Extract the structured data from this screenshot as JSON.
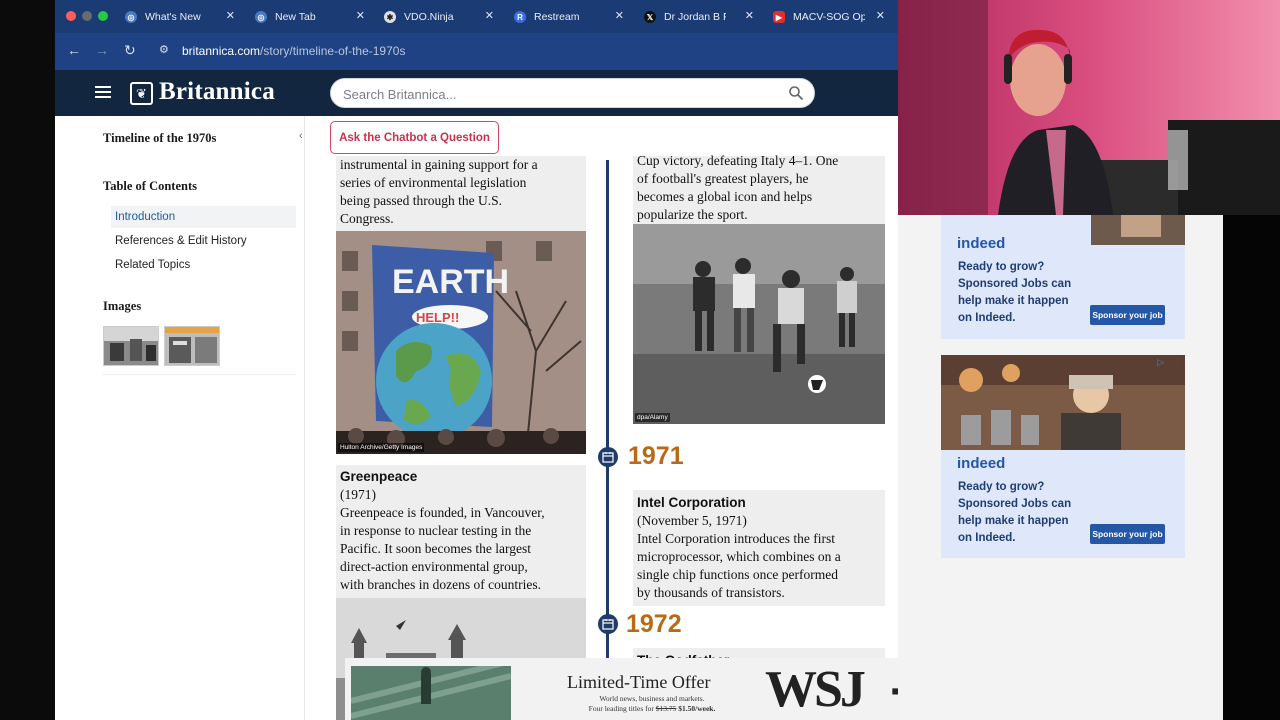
{
  "browser": {
    "tabs": [
      {
        "title": "What's New",
        "favicon": "chrome-icon",
        "color": "#4a78c2"
      },
      {
        "title": "New Tab",
        "favicon": "chrome-icon",
        "color": "#4a78c2"
      },
      {
        "title": "VDO.Ninja",
        "favicon": "vdo-ninja-icon",
        "color": "#f0f0f0"
      },
      {
        "title": "Restream",
        "favicon": "restream-icon",
        "color": "#3b6fe0"
      },
      {
        "title": "Dr Jordan B Pe",
        "favicon": "x-icon",
        "color": "#111111"
      },
      {
        "title": "MACV-SOG Op",
        "favicon": "youtube-icon",
        "color": "#e52d27"
      }
    ],
    "url_host": "britannica.com",
    "url_path": "/story/timeline-of-the-1970s"
  },
  "header": {
    "logo_text": "Britannica",
    "search_placeholder": "Search Britannica..."
  },
  "sidebar": {
    "title": "Timeline of the 1970s",
    "toc_heading": "Table of Contents",
    "toc_items": [
      {
        "label": "Introduction"
      },
      {
        "label": "References & Edit History"
      },
      {
        "label": "Related Topics"
      }
    ],
    "images_heading": "Images"
  },
  "chatbot": {
    "label": "Ask the Chatbot a Question"
  },
  "timeline": {
    "earth_day_text": [
      "instrumental in gaining support for a",
      "series of environmental legislation",
      "being passed through the U.S.",
      "Congress."
    ],
    "earth_photo_credit": "Hulton Archive/Getty Images",
    "earth_sign_main": "EARTH",
    "earth_sign_sub": "HELP!!",
    "greenpeace": {
      "title": "Greenpeace",
      "date": "(1971)",
      "text": [
        "Greenpeace is founded, in Vancouver,",
        "in response to nuclear testing in the",
        "Pacific. It soon becomes the largest",
        "direct-action environmental group,",
        "with branches in dozens of countries."
      ]
    },
    "pele_text": [
      "Cup victory, defeating Italy 4–1. One",
      "of football's greatest players, he",
      "becomes a global icon and helps",
      "popularize the sport."
    ],
    "pele_photo_credit": "dpa/Alamy",
    "year_1971": "1971",
    "intel": {
      "title": "Intel Corporation",
      "date": "(November 5, 1971)",
      "text": [
        "Intel Corporation introduces the first",
        "microprocessor, which combines on a",
        "single chip functions once performed",
        "by thousands of transistors."
      ]
    },
    "year_1972": "1972",
    "godfather_partial": "The Godfather"
  },
  "wsj_ad": {
    "headline": "Limited-Time Offer",
    "sub_line1": "World news, business and markets.",
    "sub_line2_prefix": "Four leading titles for",
    "old_price": "$13.75",
    "new_price": "$1.50/week.",
    "logo": "WSJ",
    "plus": "+"
  },
  "indeed_ads": [
    {
      "logo": "indeed",
      "copy": [
        "Ready to grow?",
        "Sponsored Jobs can",
        "help make it happen",
        "on Indeed."
      ],
      "button": "Sponsor your job"
    },
    {
      "logo": "indeed",
      "copy": [
        "Ready to grow?",
        "Sponsored Jobs can",
        "help make it happen",
        "on Indeed."
      ],
      "button": "Sponsor your job"
    }
  ],
  "colors": {
    "tabbar": "#1b3b74",
    "header": "#12263f",
    "year_accent": "#b86a17",
    "timeline": "#1f3b69",
    "chatbot_accent": "#c8324a",
    "indeed_blue": "#2557a7"
  }
}
